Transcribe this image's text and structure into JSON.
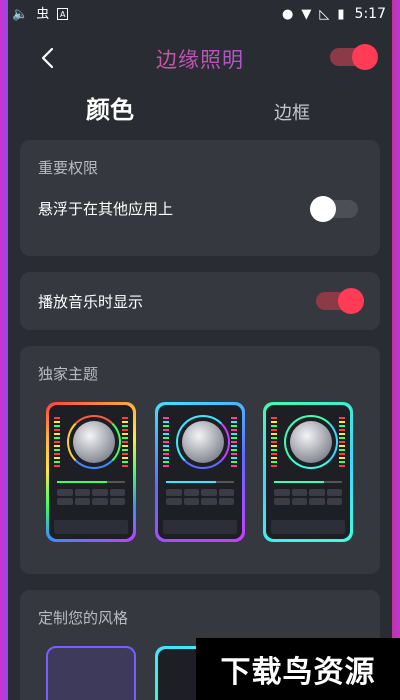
{
  "status_bar": {
    "time": "5:17",
    "left_icons": [
      "speaker-icon",
      "bug-icon",
      "notification-box-icon"
    ],
    "right_icons": [
      "location-icon",
      "wifi-icon",
      "no-signal-icon",
      "battery-charging-icon"
    ]
  },
  "header": {
    "title": "边缘照明",
    "toggle_on": true
  },
  "tabs": {
    "active": "颜色",
    "inactive": "边框"
  },
  "permissions": {
    "label": "重要权限",
    "overlay_label": "悬浮于在其他应用上",
    "overlay_on": false
  },
  "music": {
    "label": "播放音乐时显示",
    "on": true
  },
  "themes": {
    "label": "独家主题",
    "items": [
      {
        "name": "theme-rainbow"
      },
      {
        "name": "theme-cyan-purple"
      },
      {
        "name": "theme-green-cyan"
      }
    ]
  },
  "custom": {
    "label": "定制您的风格"
  },
  "watermark": "下载鸟资源",
  "colors": {
    "accent_red": "#ff3b55",
    "card_bg": "#363840",
    "page_bg": "#2a2c33"
  }
}
